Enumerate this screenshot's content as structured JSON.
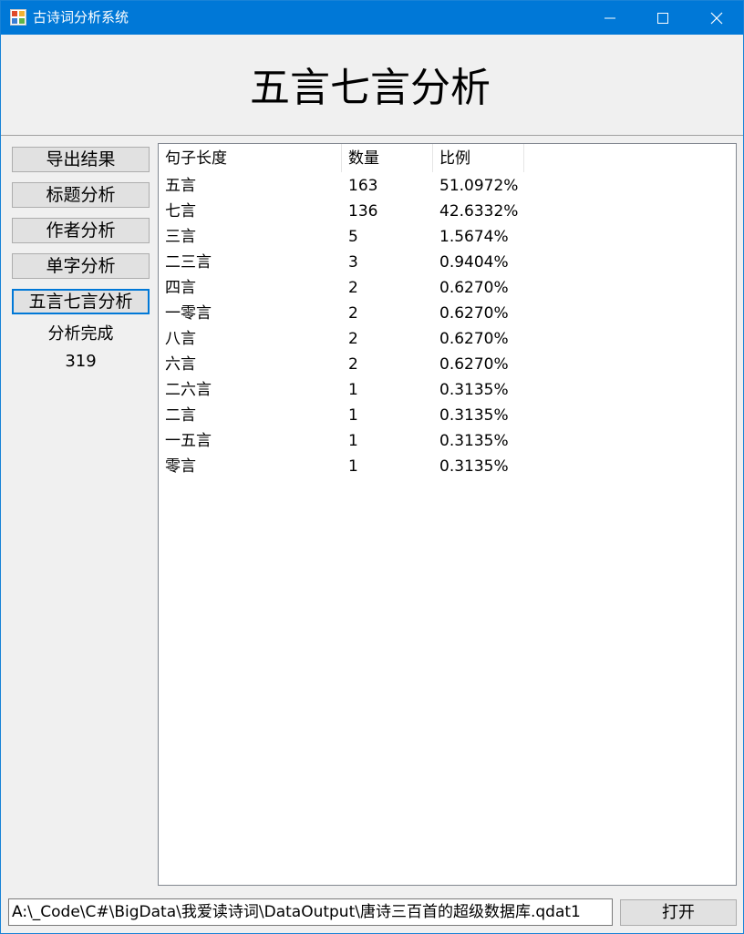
{
  "window": {
    "title": "古诗词分析系统"
  },
  "header": {
    "title": "五言七言分析"
  },
  "sidebar": {
    "buttons": [
      {
        "label": "导出结果"
      },
      {
        "label": "标题分析"
      },
      {
        "label": "作者分析"
      },
      {
        "label": "单字分析"
      },
      {
        "label": "五言七言分析"
      }
    ],
    "status": "分析完成",
    "count": "319"
  },
  "table": {
    "columns": [
      "句子长度",
      "数量",
      "比例"
    ],
    "rows": [
      [
        "五言",
        "163",
        "51.0972%"
      ],
      [
        "七言",
        "136",
        "42.6332%"
      ],
      [
        "三言",
        "5",
        "1.5674%"
      ],
      [
        "二三言",
        "3",
        "0.9404%"
      ],
      [
        "四言",
        "2",
        "0.6270%"
      ],
      [
        "一零言",
        "2",
        "0.6270%"
      ],
      [
        "八言",
        "2",
        "0.6270%"
      ],
      [
        "六言",
        "2",
        "0.6270%"
      ],
      [
        "二六言",
        "1",
        "0.3135%"
      ],
      [
        "二言",
        "1",
        "0.3135%"
      ],
      [
        "一五言",
        "1",
        "0.3135%"
      ],
      [
        "零言",
        "1",
        "0.3135%"
      ]
    ]
  },
  "footer": {
    "path": "A:\\_Code\\C#\\BigData\\我爱读诗词\\DataOutput\\唐诗三百首的超级数据库.qdat1",
    "open_label": "打开"
  },
  "colors": {
    "titlebar": "#0078d7",
    "active_border": "#0078d7",
    "window_bg": "#f0f0f0"
  },
  "icons": [
    "app-icon",
    "minimize-icon",
    "maximize-icon",
    "close-icon"
  ]
}
